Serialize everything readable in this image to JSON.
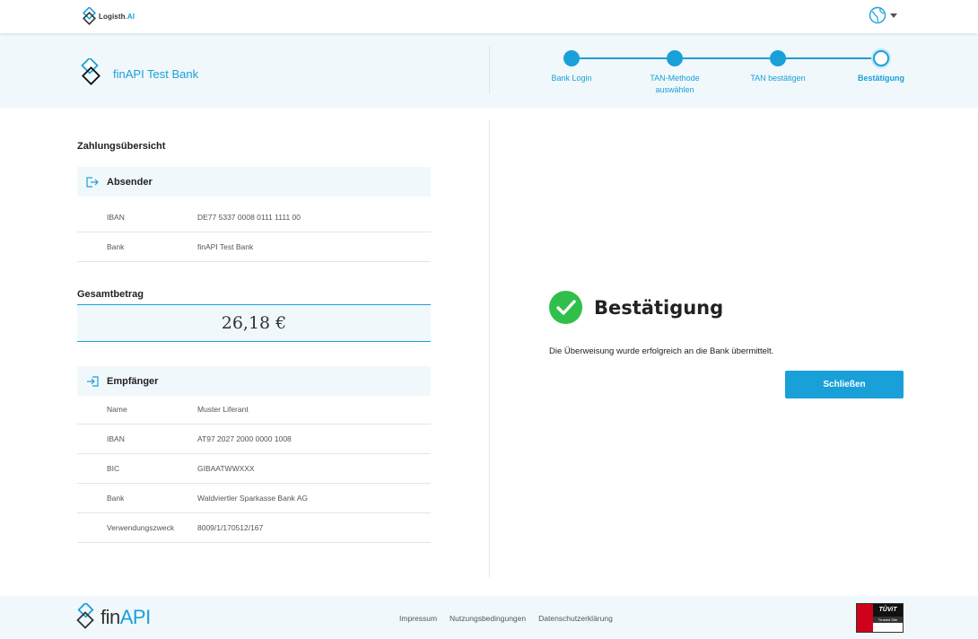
{
  "header": {
    "brand": {
      "name": "Logisth",
      "suffix": ".AI"
    },
    "language_icon": "globe-icon"
  },
  "bank": {
    "name": "finAPI Test Bank"
  },
  "steps": [
    {
      "label": "Bank Login",
      "state": "done"
    },
    {
      "label": "TAN-Methode auswählen",
      "state": "done"
    },
    {
      "label": "TAN bestätigen",
      "state": "done"
    },
    {
      "label": "Bestätigung",
      "state": "current"
    }
  ],
  "summary": {
    "title": "Zahlungsübersicht",
    "sender": {
      "title": "Absender",
      "rows": [
        {
          "key": "IBAN",
          "value": "DE77 5337 0008 0111 1111 00"
        },
        {
          "key": "Bank",
          "value": "finAPI Test Bank"
        }
      ]
    },
    "total": {
      "label": "Gesamtbetrag",
      "amount": "26,18 €"
    },
    "recipient": {
      "title": "Empfänger",
      "rows": [
        {
          "key": "Name",
          "value": "Muster Liferant"
        },
        {
          "key": "IBAN",
          "value": "AT97 2027 2000 0000 1008"
        },
        {
          "key": "BIC",
          "value": "GIBAATWWXXX"
        },
        {
          "key": "Bank",
          "value": "Waldviertler Sparkasse Bank AG"
        },
        {
          "key": "Verwendungszweck",
          "value": "8009/1/170512/167"
        }
      ]
    }
  },
  "confirmation": {
    "title": "Bestätigung",
    "message": "Die Überweisung wurde erfolgreich an die Bank übermittelt.",
    "close_label": "Schließen"
  },
  "footer": {
    "brand_fin": "fin",
    "brand_api": "API",
    "links": [
      "Impressum",
      "Nutzungsbedingungen",
      "Datenschutzerklärung"
    ],
    "seal_text": "TÜViT",
    "seal_sub": "Trusted Site"
  },
  "colors": {
    "accent": "#1aa0d8",
    "success": "#2fbf4a",
    "band": "#f1f8fb"
  }
}
